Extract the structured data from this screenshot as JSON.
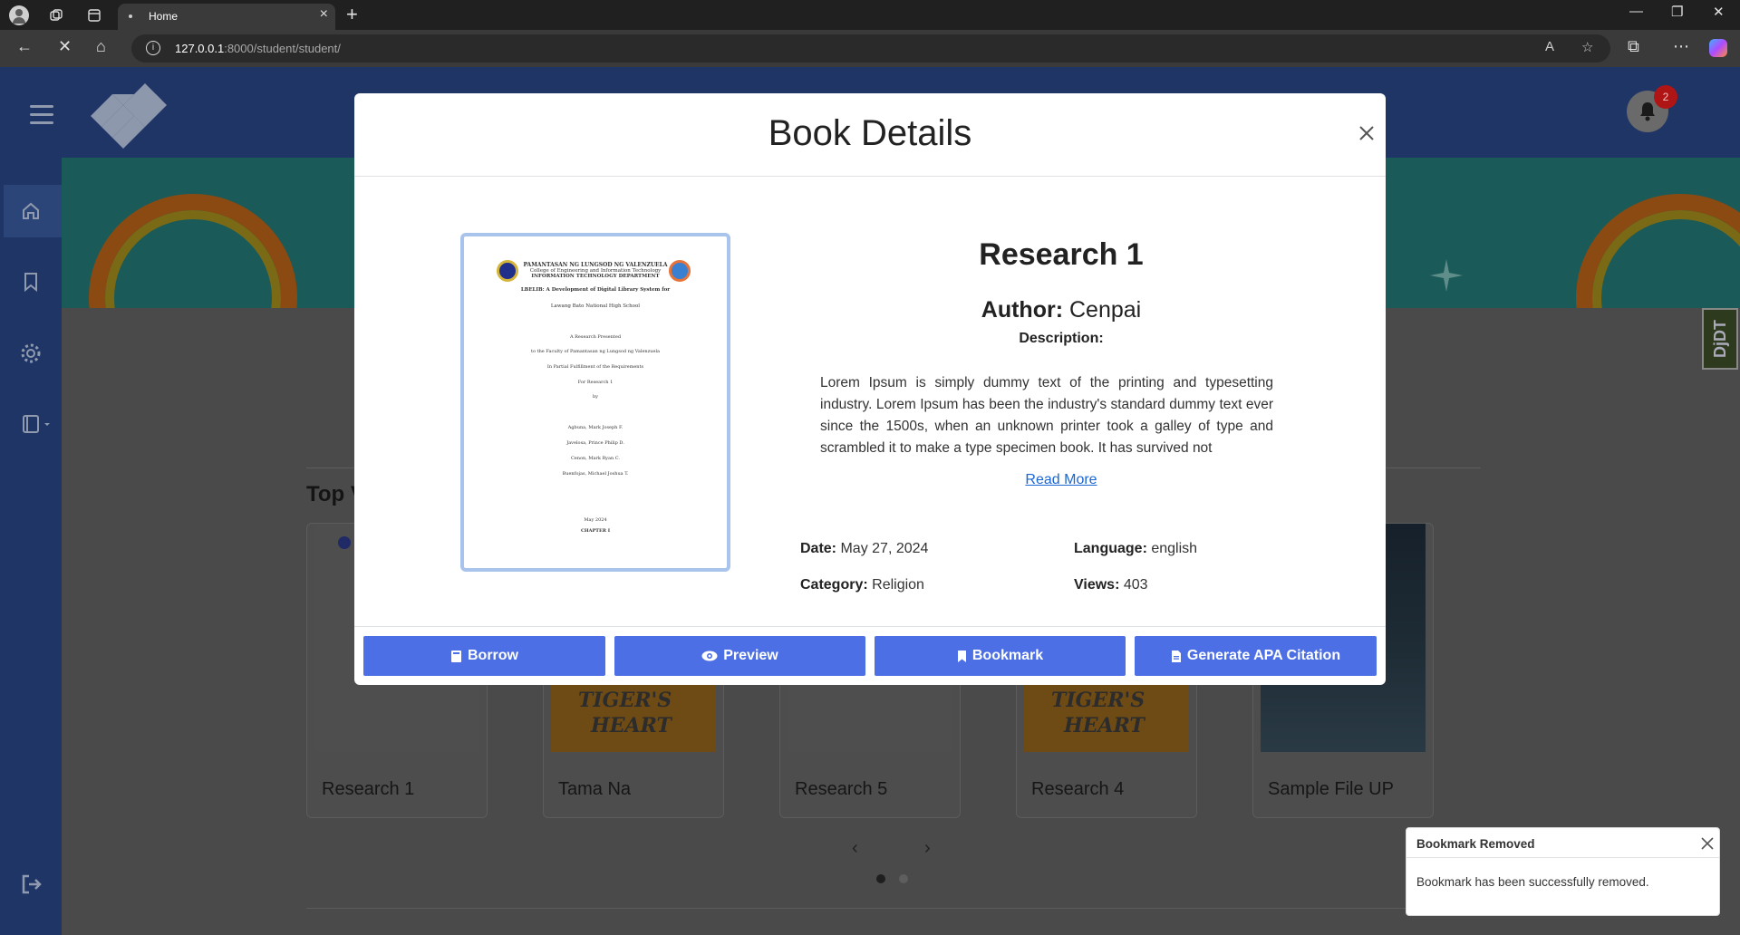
{
  "browser": {
    "tab_title": "Home",
    "url_host": "127.0.0.1",
    "url_rest": ":8000/student/student/"
  },
  "header": {
    "notification_count": "2"
  },
  "section": {
    "title": "Top V"
  },
  "cards": [
    {
      "title": "Research 1"
    },
    {
      "title": "Tama Na"
    },
    {
      "title": "Research 5"
    },
    {
      "title": "Research 4"
    },
    {
      "title": "Sample File UP"
    }
  ],
  "carousel": {
    "prev": "‹",
    "next": "›"
  },
  "modal": {
    "title": "Book Details",
    "book_title": "Research 1",
    "author_label": "Author:",
    "author": "Cenpai",
    "description_label": "Description:",
    "description": "Lorem Ipsum is simply dummy text of the printing and typesetting industry. Lorem Ipsum has been the industry's standard dummy text ever since the 1500s, when an unknown printer took a galley of type and scrambled it to make a type specimen book. It has survived not",
    "read_more": "Read More",
    "date_label": "Date:",
    "date": "May 27, 2024",
    "language_label": "Language:",
    "language": "english",
    "category_label": "Category:",
    "category": "Religion",
    "views_label": "Views:",
    "views": "403",
    "buttons": {
      "borrow": "Borrow",
      "preview": "Preview",
      "bookmark": "Bookmark",
      "citation": "Generate APA Citation"
    },
    "cover": {
      "university": "PAMANTASAN NG LUNGSOD NG VALENZUELA",
      "college": "College of Engineering and Information Technology",
      "department": "INFORMATION TECHNOLOGY DEPARTMENT",
      "project": "LBELIB: A Development of Digital Library System for",
      "school": "Lawang Bato National High School",
      "l1": "A Research Presented",
      "l2": "to the Faculty of Pamantasan ng Lungsod ng Valenzuela",
      "l3": "In Partial Fulfillment of the Requirements",
      "l4": "For Research 1",
      "l5": "by",
      "a1": "Agbuna, Mark Joseph F.",
      "a2": "Javelosa, Prince Philip D.",
      "a3": "Cenon, Mark Ryan C.",
      "a4": "Buenfojas, Michael Joshua T.",
      "date": "May 2024",
      "chapter": "CHAPTER I"
    }
  },
  "toast": {
    "title": "Bookmark Removed",
    "body": "Bookmark has been successfully removed."
  },
  "devtools_tab": "DjDT",
  "colors": {
    "primary_button": "#4c6fe6",
    "sidebar": "#1e3566",
    "badge": "#b01515",
    "link": "#1a66d2"
  }
}
